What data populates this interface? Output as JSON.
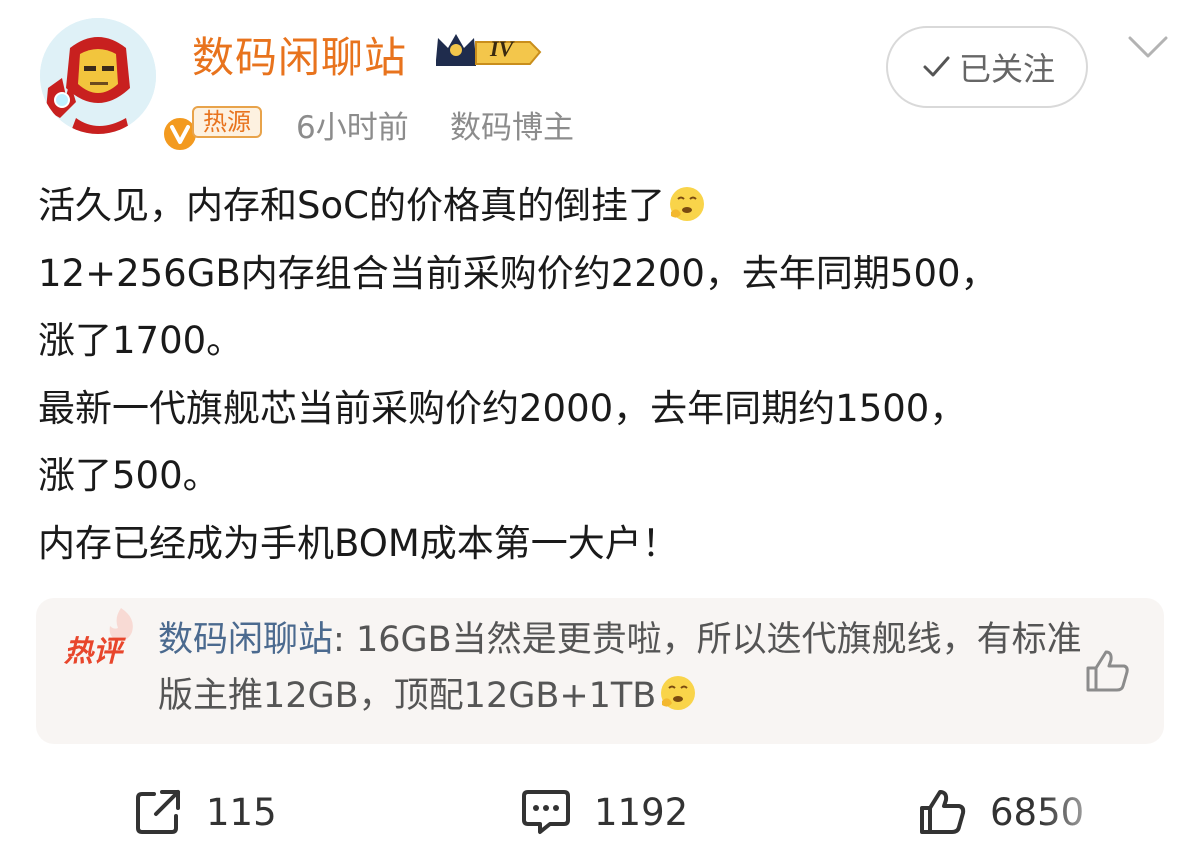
{
  "author": {
    "name": "数码闲聊站",
    "level_badge": "IV",
    "hot_tag": "热源",
    "time_ago": "6小时前",
    "role": "数码博主"
  },
  "follow_button": {
    "label": "已关注"
  },
  "post": {
    "lines": [
      "活久见，内存和SoC的价格真的倒挂了",
      "12+256GB内存组合当前采购价约2200，去年同期500，",
      "涨了1700。",
      "最新一代旗舰芯当前采购价约2000，去年同期约1500，",
      "涨了500。",
      "内存已经成为手机BOM成本第一大户！"
    ],
    "emoji": "face-holding-back-tears-icon"
  },
  "hot_comment": {
    "label": "热评",
    "user": "数码闲聊站",
    "separator": ":",
    "text": " 16GB当然是更贵啦，所以迭代旗舰线，有标准版主推12GB，顶配12GB+1TB"
  },
  "actions": {
    "reposts": "115",
    "comments": "1192",
    "likes": "6850"
  },
  "colors": {
    "author_name": "#e8731d",
    "hot_label": "#e8462c",
    "comment_user": "#4b6a8f",
    "meta_gray": "#8c8c8c"
  }
}
